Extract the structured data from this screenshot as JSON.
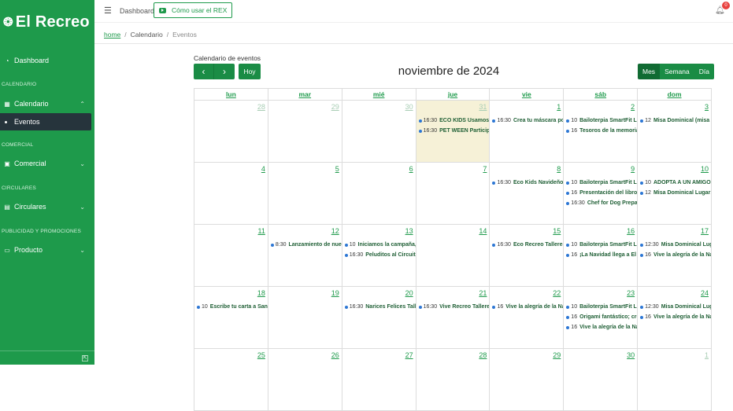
{
  "brand": {
    "name": "El Recreo"
  },
  "sidebar": {
    "dashboard": "Dashboard",
    "sections": [
      "CALENDARIO",
      "COMERCIAL",
      "CIRCULARES",
      "PUBLICIDAD Y PROMOCIONES"
    ],
    "calendario": "Calendario",
    "eventos": "Eventos",
    "comercial": "Comercial",
    "circulares": "Circulares",
    "producto": "Producto"
  },
  "topbar": {
    "dashboard": "Dashboard",
    "howto": "Cómo usar el REX",
    "badge": "0"
  },
  "breadcrumb": {
    "home": "home",
    "calendario": "Calendario",
    "eventos": "Eventos"
  },
  "calendar": {
    "heading": "Calendario de eventos",
    "today": "Hoy",
    "title": "noviembre de 2024",
    "views": [
      "Mes",
      "Semana",
      "Día"
    ],
    "weekdays": [
      "lun",
      "mar",
      "mié",
      "jue",
      "vie",
      "sáb",
      "dom"
    ],
    "weeks": [
      [
        {
          "d": "28",
          "other": true,
          "events": []
        },
        {
          "d": "29",
          "other": true,
          "events": []
        },
        {
          "d": "30",
          "other": true,
          "events": []
        },
        {
          "d": "31",
          "other": true,
          "today": true,
          "events": [
            {
              "t": "16:30",
              "n": "ECO KIDS Usamos para"
            },
            {
              "t": "16:30",
              "n": "PET WEEN Participa"
            }
          ]
        },
        {
          "d": "1",
          "events": [
            {
              "t": "16:30",
              "n": "Crea tu máscara por"
            }
          ]
        },
        {
          "d": "2",
          "events": [
            {
              "t": "10",
              "n": "Bailoterpia SmartFit Lu"
            },
            {
              "t": "16",
              "n": "Tesoros de la memoria;"
            }
          ]
        },
        {
          "d": "3",
          "events": [
            {
              "t": "12",
              "n": "Misa Dominical (misa d"
            }
          ]
        }
      ],
      [
        {
          "d": "4",
          "events": []
        },
        {
          "d": "5",
          "events": []
        },
        {
          "d": "6",
          "events": []
        },
        {
          "d": "7",
          "events": []
        },
        {
          "d": "8",
          "events": [
            {
              "t": "16:30",
              "n": "Eco Kids Navideño T"
            }
          ]
        },
        {
          "d": "9",
          "events": [
            {
              "t": "10",
              "n": "Bailoterpia SmartFit Lu"
            },
            {
              "t": "16",
              "n": "Presentación del libro '"
            },
            {
              "t": "16:30",
              "n": "Chef for Dog Prepar"
            }
          ]
        },
        {
          "d": "10",
          "events": [
            {
              "t": "10",
              "n": "ADOPTA A UN AMIGO"
            },
            {
              "t": "12",
              "n": "Misa Dominical Lugar:"
            }
          ]
        }
      ],
      [
        {
          "d": "11",
          "events": []
        },
        {
          "d": "12",
          "events": [
            {
              "t": "8:30",
              "n": "Lanzamiento de nuest"
            }
          ]
        },
        {
          "d": "13",
          "events": [
            {
              "t": "10",
              "n": "Iniciamos la campaña, l"
            },
            {
              "t": "16:30",
              "n": "Peluditos al Circuito"
            }
          ]
        },
        {
          "d": "14",
          "events": []
        },
        {
          "d": "15",
          "events": [
            {
              "t": "16:30",
              "n": "Eco Recreo Talleres I"
            }
          ]
        },
        {
          "d": "16",
          "events": [
            {
              "t": "10",
              "n": "Bailoterpia SmartFit Lu"
            },
            {
              "t": "16",
              "n": "¡La Navidad llega a El F"
            }
          ]
        },
        {
          "d": "17",
          "events": [
            {
              "t": "12:30",
              "n": "Misa Dominical Luga"
            },
            {
              "t": "16",
              "n": "Vive la alegría de la Na"
            }
          ]
        }
      ],
      [
        {
          "d": "18",
          "events": [
            {
              "t": "10",
              "n": "Escribe tu carta a Santa"
            }
          ]
        },
        {
          "d": "19",
          "events": []
        },
        {
          "d": "20",
          "events": [
            {
              "t": "16:30",
              "n": "Narices Felices Taller"
            }
          ]
        },
        {
          "d": "21",
          "events": [
            {
              "t": "16:30",
              "n": "Vive Recreo Talleres"
            }
          ]
        },
        {
          "d": "22",
          "events": [
            {
              "t": "16",
              "n": "Vive la alegría de la Na"
            }
          ]
        },
        {
          "d": "23",
          "events": [
            {
              "t": "10",
              "n": "Bailoterpia SmartFit Lu"
            },
            {
              "t": "16",
              "n": "Origami fantástico; cre"
            },
            {
              "t": "16",
              "n": "Vive la alegría de la Na"
            }
          ]
        },
        {
          "d": "24",
          "events": [
            {
              "t": "12:30",
              "n": "Misa Dominical Luga"
            },
            {
              "t": "16",
              "n": "Vive la alegría de la Na"
            }
          ]
        }
      ],
      [
        {
          "d": "25",
          "events": []
        },
        {
          "d": "26",
          "events": []
        },
        {
          "d": "27",
          "events": []
        },
        {
          "d": "28",
          "events": []
        },
        {
          "d": "29",
          "events": []
        },
        {
          "d": "30",
          "events": []
        },
        {
          "d": "1",
          "other": true,
          "events": []
        }
      ]
    ]
  }
}
